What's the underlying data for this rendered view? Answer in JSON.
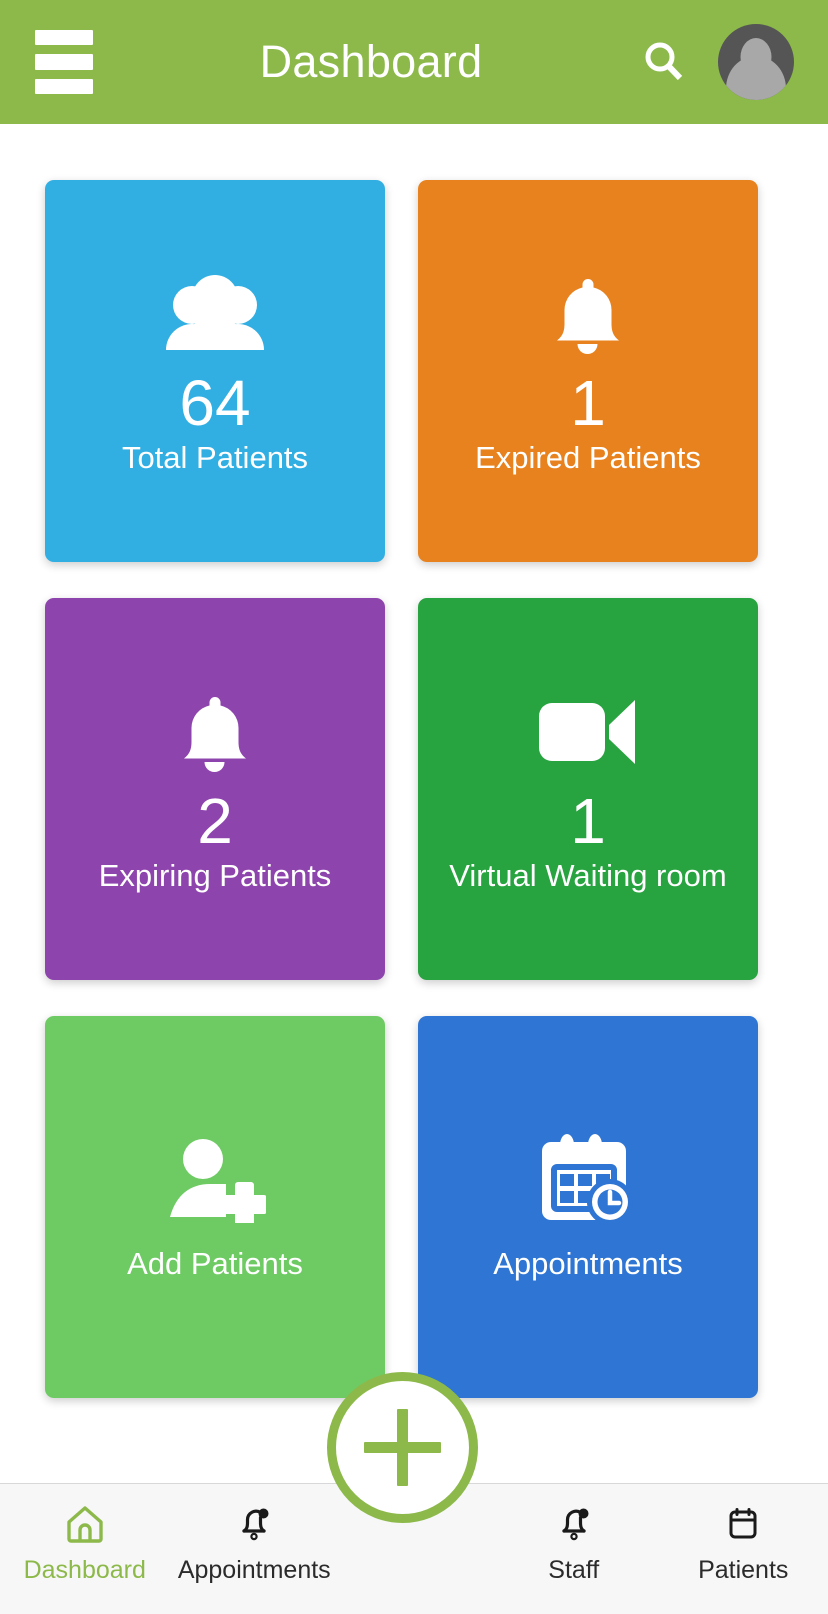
{
  "theme": {
    "brand_green": "#8cb94a",
    "header_text": "#ffffff",
    "page_background": "#ffffff",
    "nav_background": "#f7f7f7",
    "nav_label": "#2b2b2b",
    "nav_active_label": "#8cb94a"
  },
  "header": {
    "menu_icon": "hamburger-menu-icon",
    "title": "Dashboard",
    "search_icon": "search-icon",
    "avatar_icon": "user-avatar-icon"
  },
  "cards": [
    {
      "id": "total-patients",
      "icon": "people-group-icon",
      "value": "64",
      "label": "Total Patients",
      "color": "#31afe3"
    },
    {
      "id": "expired-patients",
      "icon": "bell-icon",
      "value": "1",
      "label": "Expired Patients",
      "color": "#e8821e"
    },
    {
      "id": "expiring-patients",
      "icon": "bell-icon",
      "value": "2",
      "label": "Expiring Patients",
      "color": "#8e44ad"
    },
    {
      "id": "virtual-waiting-room",
      "icon": "video-camera-icon",
      "value": "1",
      "label": "Virtual Waiting room",
      "color": "#27a340"
    },
    {
      "id": "add-patients",
      "icon": "person-add-icon",
      "value": "",
      "label": "Add Patients",
      "color": "#6ecb63"
    },
    {
      "id": "appointments",
      "icon": "calendar-clock-icon",
      "value": "",
      "label": "Appointments",
      "color": "#2e75d4"
    }
  ],
  "fab": {
    "icon": "plus-icon",
    "label": "Add"
  },
  "bottom_nav": {
    "items": [
      {
        "id": "dashboard",
        "icon": "home-icon",
        "label": "Dashboard",
        "active": true
      },
      {
        "id": "appointments",
        "icon": "bell-alert-icon",
        "label": "Appointments",
        "active": false
      },
      {
        "id": "staff",
        "icon": "bell-alert-icon",
        "label": "Staff",
        "active": false
      },
      {
        "id": "patients",
        "icon": "calendar-icon",
        "label": "Patients",
        "active": false
      }
    ]
  }
}
